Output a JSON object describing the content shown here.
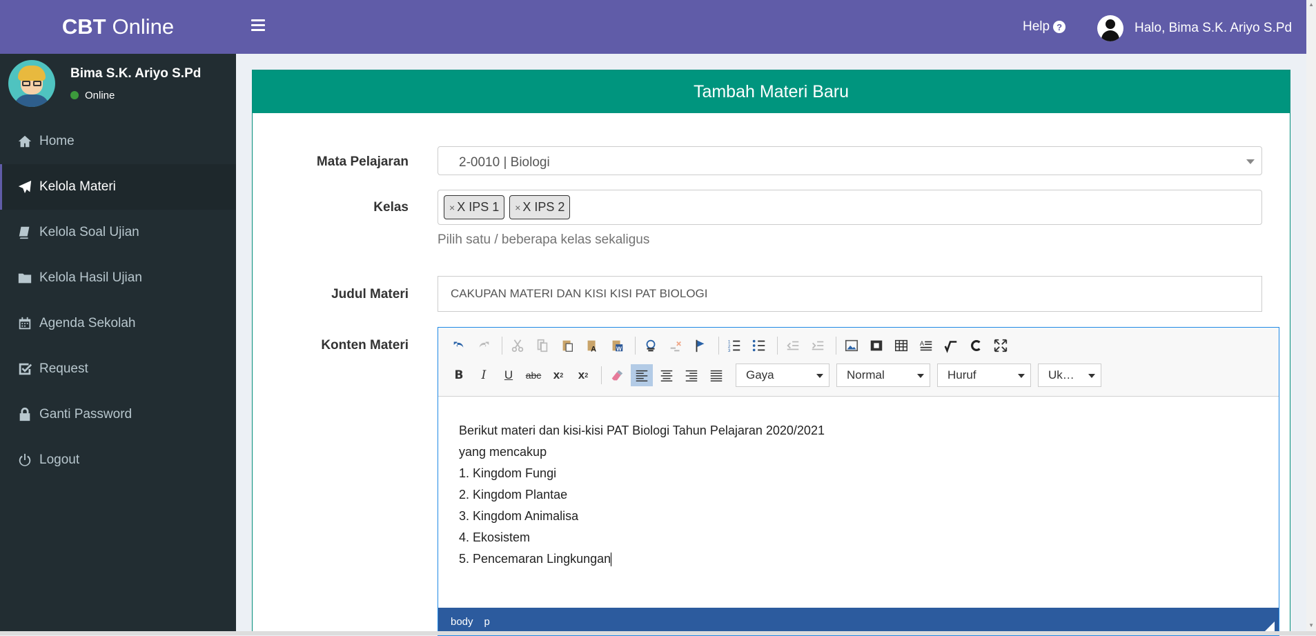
{
  "app": {
    "logo_bold": "CBT",
    "logo_rest": "Online"
  },
  "sidebar": {
    "user_name": "Bima S.K. Ariyo S.Pd",
    "status": "Online",
    "items": [
      {
        "label": "Home",
        "icon": "home-icon"
      },
      {
        "label": "Kelola Materi",
        "icon": "paper-plane-icon",
        "active": true
      },
      {
        "label": "Kelola Soal Ujian",
        "icon": "book-icon"
      },
      {
        "label": "Kelola Hasil Ujian",
        "icon": "folder-icon"
      },
      {
        "label": "Agenda Sekolah",
        "icon": "calendar-icon"
      },
      {
        "label": "Request",
        "icon": "check-square-icon"
      },
      {
        "label": "Ganti Password",
        "icon": "lock-icon"
      },
      {
        "label": "Logout",
        "icon": "power-icon"
      }
    ]
  },
  "topbar": {
    "help": "Help",
    "greeting": "Halo, Bima S.K. Ariyo S.Pd"
  },
  "form": {
    "title": "Tambah Materi Baru",
    "mata_pelajaran_label": "Mata Pelajaran",
    "mata_pelajaran_value": "2-0010 | Biologi",
    "kelas_label": "Kelas",
    "kelas_tags": [
      "X IPS 1",
      "X IPS 2"
    ],
    "kelas_help": "Pilih satu / beberapa kelas sekaligus",
    "judul_label": "Judul Materi",
    "judul_value": "CAKUPAN MATERI DAN KISI KISI PAT BIOLOGI",
    "konten_label": "Konten Materi"
  },
  "editor": {
    "style_combo": "Gaya",
    "format_combo": "Normal",
    "font_combo": "Huruf",
    "size_combo": "Uk…",
    "content_lines": [
      "Berikut materi dan kisi-kisi PAT Biologi Tahun Pelajaran 2020/2021",
      "yang mencakup",
      "1. Kingdom Fungi",
      "2. Kingdom Plantae",
      "3. Kingdom Animalisa",
      "4. Ekosistem",
      "5. Pencemaran Lingkungan"
    ],
    "path": [
      "body",
      "p"
    ]
  },
  "colors": {
    "header": "#605ca8",
    "sidebar": "#222d32",
    "box_header": "#00957e",
    "editor_status": "#2c5b9e"
  }
}
